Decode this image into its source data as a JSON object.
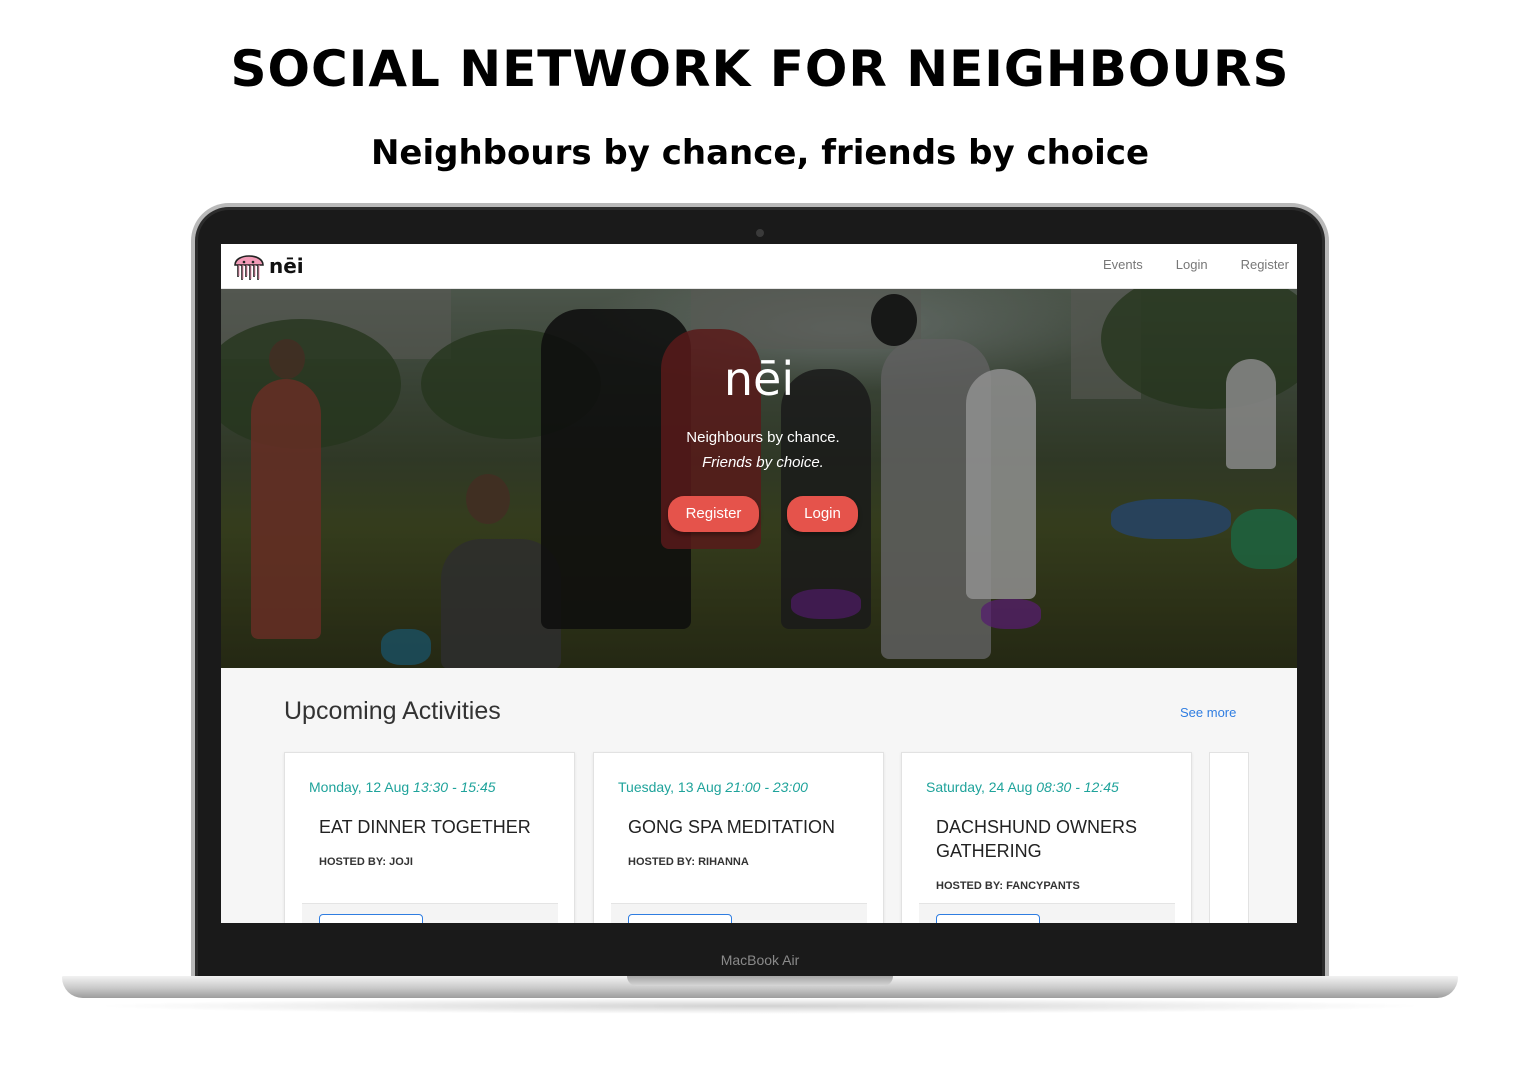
{
  "headline": "SOCIAL NETWORK FOR NEIGHBOURS",
  "tagline": "Neighbours by chance, friends by choice",
  "device_label": "MacBook Air",
  "navbar": {
    "brand": "nēi",
    "links": [
      "Events",
      "Login",
      "Register"
    ]
  },
  "hero": {
    "title": "nēi",
    "line1": "Neighbours by chance.",
    "line2": "Friends by choice.",
    "register_label": "Register",
    "login_label": "Login",
    "button_color": "#e5534b"
  },
  "activities": {
    "title": "Upcoming Activities",
    "see_more": "See more",
    "cards": [
      {
        "date": "Monday, 12 Aug",
        "time": "13:30 - 15:45",
        "title": "EAT DINNER TOGETHER",
        "host": "HOSTED BY: JOJI"
      },
      {
        "date": "Tuesday, 13 Aug",
        "time": "21:00 - 23:00",
        "title": "GONG SPA MEDITATION",
        "host": "HOSTED BY: RIHANNA"
      },
      {
        "date": "Saturday, 24 Aug",
        "time": "08:30 - 12:45",
        "title": "DACHSHUND OWNERS GATHERING",
        "host": "HOSTED BY: FANCYPANTS"
      }
    ]
  },
  "colors": {
    "accent_teal": "#1fa39b",
    "link_blue": "#2f7de1"
  }
}
